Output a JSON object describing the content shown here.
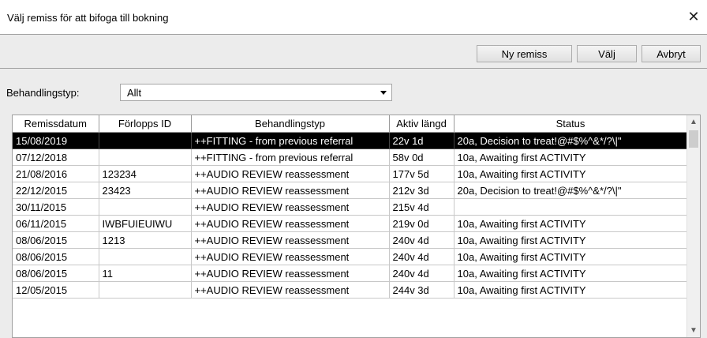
{
  "window": {
    "title": "Välj remiss för att bifoga till bokning",
    "close_glyph": "✕"
  },
  "toolbar": {
    "new_label": "Ny remiss",
    "select_label": "Välj",
    "cancel_label": "Avbryt"
  },
  "filter": {
    "label": "Behandlingstyp:",
    "value": "Allt"
  },
  "table": {
    "columns": [
      "Remissdatum",
      "Förlopps ID",
      "Behandlingstyp",
      "Aktiv längd",
      "Status"
    ],
    "rows": [
      [
        "15/08/2019",
        "",
        "++FITTING - from previous referral",
        "22v 1d",
        "20a, Decision to treat!@#$%^&*/?\\|\""
      ],
      [
        "07/12/2018",
        "",
        "++FITTING - from previous referral",
        "58v 0d",
        "10a, Awaiting first ACTIVITY"
      ],
      [
        "21/08/2016",
        "123234",
        "++AUDIO REVIEW reassessment",
        "177v 5d",
        "10a, Awaiting first ACTIVITY"
      ],
      [
        "22/12/2015",
        "23423",
        "++AUDIO REVIEW reassessment",
        "212v 3d",
        "20a, Decision to treat!@#$%^&*/?\\|\""
      ],
      [
        "30/11/2015",
        "",
        "++AUDIO REVIEW reassessment",
        "215v 4d",
        ""
      ],
      [
        "06/11/2015",
        "IWBFUIEUIWU",
        "++AUDIO REVIEW reassessment",
        "219v 0d",
        "10a, Awaiting first ACTIVITY"
      ],
      [
        "08/06/2015",
        "1213",
        "++AUDIO REVIEW reassessment",
        "240v 4d",
        "10a, Awaiting first ACTIVITY"
      ],
      [
        "08/06/2015",
        "",
        "++AUDIO REVIEW reassessment",
        "240v 4d",
        "10a, Awaiting first ACTIVITY"
      ],
      [
        "08/06/2015",
        "11",
        "++AUDIO REVIEW reassessment",
        "240v 4d",
        "10a, Awaiting first ACTIVITY"
      ],
      [
        "12/05/2015",
        "",
        "++AUDIO REVIEW reassessment",
        "244v 3d",
        "10a, Awaiting first ACTIVITY"
      ]
    ],
    "selected_row": 0
  },
  "icons": {
    "close": "close-icon",
    "dropdown": "chevron-down-icon",
    "scroll_up": "chevron-up-icon",
    "scroll_down": "chevron-down-icon"
  },
  "colors": {
    "selected_bg": "#000000",
    "selected_fg": "#ffffff",
    "toolbar_bg": "#ececec"
  }
}
